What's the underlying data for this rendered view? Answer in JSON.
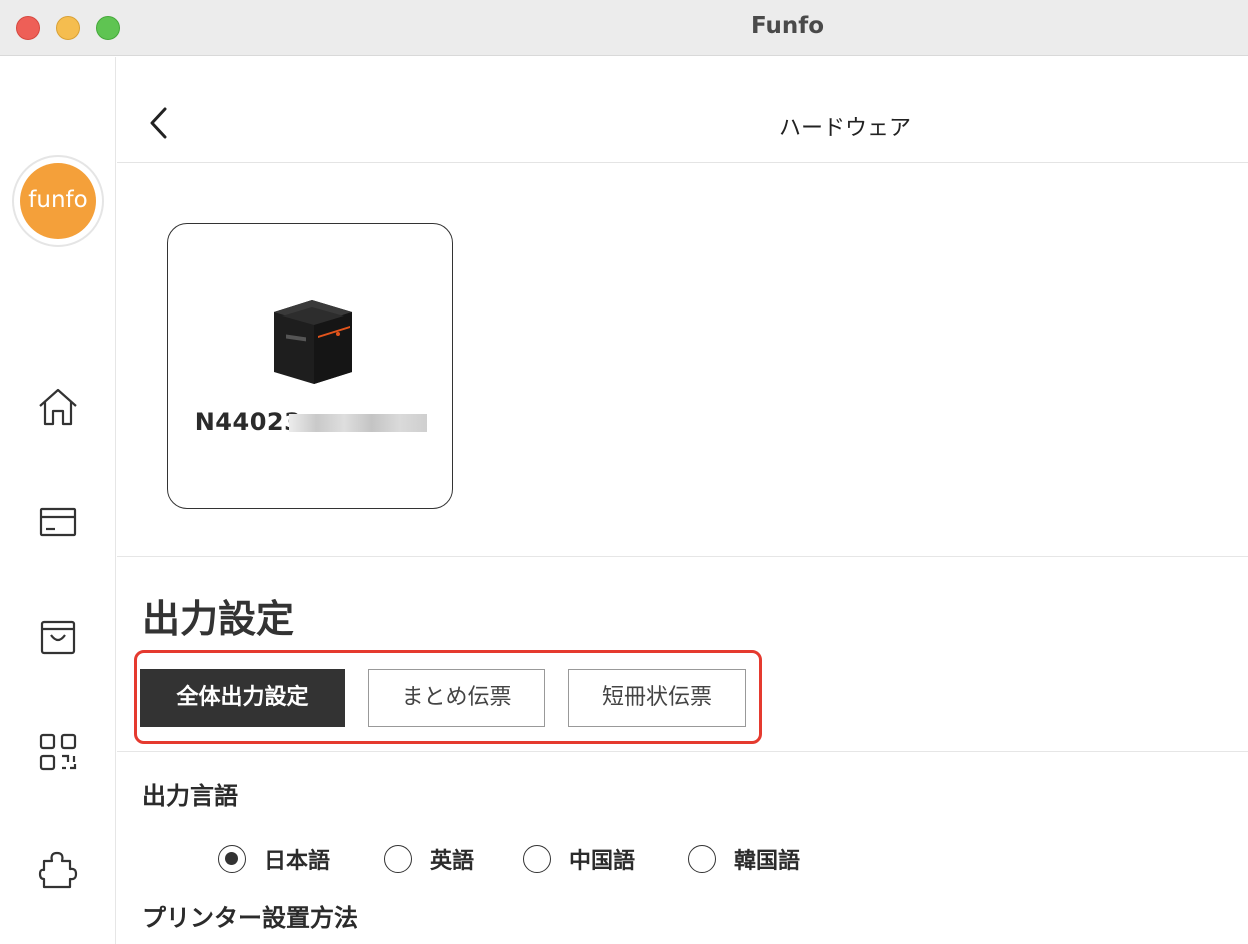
{
  "window": {
    "title": "Funfo"
  },
  "sidebar": {
    "logo_text": "funfo",
    "items": [
      {
        "icon": "home-icon"
      },
      {
        "icon": "card-icon"
      },
      {
        "icon": "shopping-bag-icon"
      },
      {
        "icon": "qr-code-icon"
      },
      {
        "icon": "puzzle-icon"
      }
    ]
  },
  "header": {
    "title": "ハードウェア",
    "back_icon": "chevron-left-icon"
  },
  "device": {
    "serial": "N44023",
    "icon": "printer-icon"
  },
  "output_settings": {
    "title": "出力設定",
    "tabs": [
      {
        "label": "全体出力設定",
        "active": true
      },
      {
        "label": "まとめ伝票",
        "active": false
      },
      {
        "label": "短冊状伝票",
        "active": false
      }
    ]
  },
  "output_language": {
    "title": "出力言語",
    "options": [
      {
        "label": "日本語",
        "selected": true
      },
      {
        "label": "英語",
        "selected": false
      },
      {
        "label": "中国語",
        "selected": false
      },
      {
        "label": "韓国語",
        "selected": false
      }
    ]
  },
  "printer_setup": {
    "title": "プリンター設置方法"
  },
  "colors": {
    "accent_orange": "#f4a03a",
    "highlight_red": "#e53a2f",
    "active_tab": "#333333"
  }
}
